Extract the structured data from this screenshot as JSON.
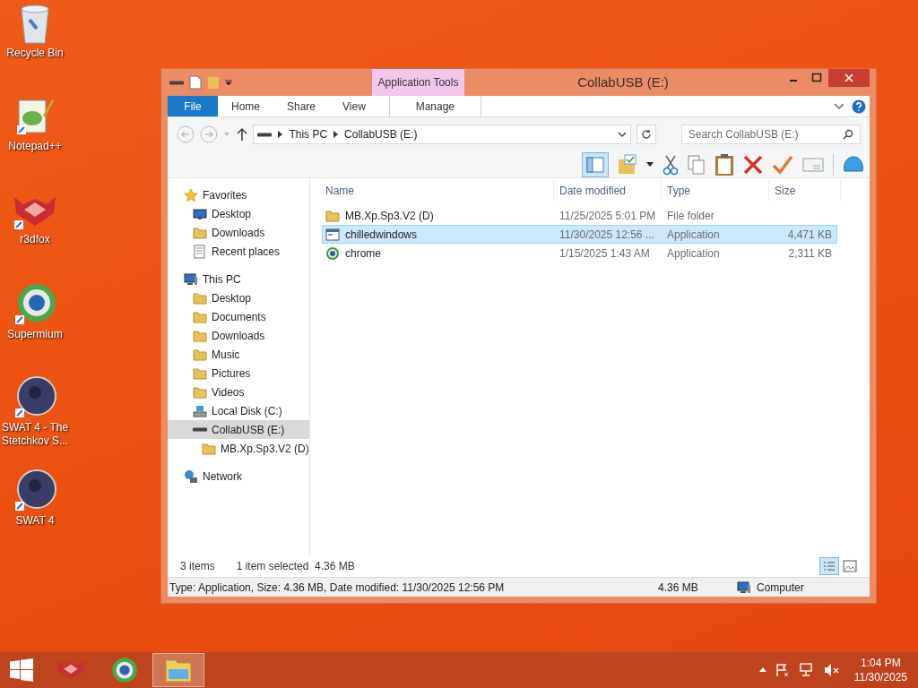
{
  "desktop_icons": [
    {
      "label": "Recycle Bin",
      "kind": "bin"
    },
    {
      "label": "Notepad++",
      "kind": "notepad"
    },
    {
      "label": "r3dfox",
      "kind": "fox"
    },
    {
      "label": "Supermium",
      "kind": "browser"
    },
    {
      "label": "SWAT 4 - The Stetchkov S...",
      "kind": "game"
    },
    {
      "label": "SWAT 4",
      "kind": "game"
    }
  ],
  "window": {
    "title": "CollabUSB (E:)",
    "context_tab_group": "Application Tools"
  },
  "ribbon_tabs": [
    {
      "label": "File",
      "kind": "file"
    },
    {
      "label": "Home",
      "kind": "tab"
    },
    {
      "label": "Share",
      "kind": "tab"
    },
    {
      "label": "View",
      "kind": "tab"
    },
    {
      "label": "Manage",
      "kind": "context"
    }
  ],
  "address": {
    "path": [
      "This PC",
      "CollabUSB (E:)"
    ]
  },
  "search": {
    "placeholder": "Search CollabUSB (E:)"
  },
  "navigation": [
    {
      "label": "Favorites",
      "kind": "star",
      "selected": false,
      "children": [
        {
          "label": "Desktop",
          "kind": "desktop",
          "selected": false
        },
        {
          "label": "Downloads",
          "kind": "folder",
          "selected": false
        },
        {
          "label": "Recent places",
          "kind": "recent",
          "selected": false
        }
      ]
    },
    {
      "label": "This PC",
      "kind": "pc",
      "selected": false,
      "children": [
        {
          "label": "Desktop",
          "kind": "folder",
          "selected": false
        },
        {
          "label": "Documents",
          "kind": "folder",
          "selected": false
        },
        {
          "label": "Downloads",
          "kind": "folder",
          "selected": false
        },
        {
          "label": "Music",
          "kind": "folder",
          "selected": false
        },
        {
          "label": "Pictures",
          "kind": "folder",
          "selected": false
        },
        {
          "label": "Videos",
          "kind": "folder",
          "selected": false
        },
        {
          "label": "Local Disk (C:)",
          "kind": "disk",
          "selected": false
        },
        {
          "label": "CollabUSB (E:)",
          "kind": "usb",
          "selected": true,
          "children": [
            {
              "label": "MB.Xp.Sp3.V2 (D)",
              "kind": "folder",
              "selected": false
            }
          ]
        }
      ]
    },
    {
      "label": "Network",
      "kind": "network",
      "selected": false
    }
  ],
  "table": {
    "columns": [
      "Name",
      "Date modified",
      "Type",
      "Size"
    ],
    "rows": [
      {
        "name": "MB.Xp.Sp3.V2 (D)",
        "date": "11/25/2025 5:01 PM",
        "type": "File folder",
        "kind": "folder",
        "selected": false
      },
      {
        "name": "chilledwindows",
        "date": "11/30/2025 12:56 ...",
        "type": "Application",
        "size": "4,471 KB",
        "kind": "app",
        "selected": true
      },
      {
        "name": "chrome",
        "date": "1/15/2025 1:43 AM",
        "type": "Application",
        "size": "2,311 KB",
        "kind": "browser",
        "selected": false
      }
    ]
  },
  "item_status": {
    "count": "3 items",
    "selection": "1 item selected  4.36 MB"
  },
  "status_bar": {
    "details": "Type: Application, Size: 4.36 MB, Date modified: 11/30/2025 12:56 PM",
    "size": "4.36 MB",
    "zone": "Computer"
  },
  "taskbar": {
    "apps": [
      {
        "kind": "fox",
        "active": false
      },
      {
        "kind": "browser",
        "active": false
      },
      {
        "kind": "explorer",
        "active": true
      }
    ],
    "time": "1:04 PM",
    "date": "11/30/2025"
  }
}
